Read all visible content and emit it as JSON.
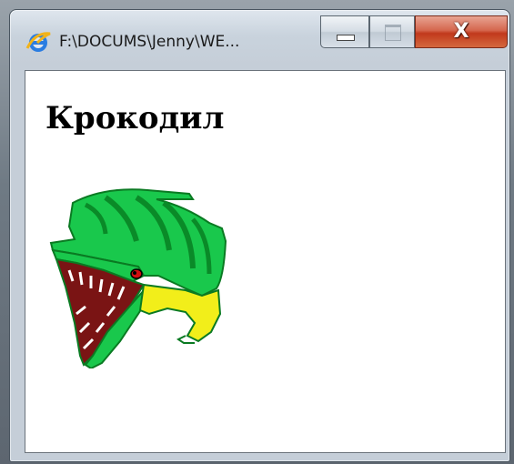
{
  "window": {
    "title": "F:\\DOCUMS\\Jenny\\WE...",
    "buttons": {
      "close_glyph": "X"
    }
  },
  "page": {
    "heading": "Крокодил",
    "image": {
      "icon": "crocodile-clipart"
    }
  },
  "colors": {
    "croc_green": "#19c84c",
    "croc_dark_green": "#0a8a28",
    "croc_belly": "#f2ee1a",
    "croc_mouth": "#7a1414",
    "close_red": "#c1391c"
  }
}
